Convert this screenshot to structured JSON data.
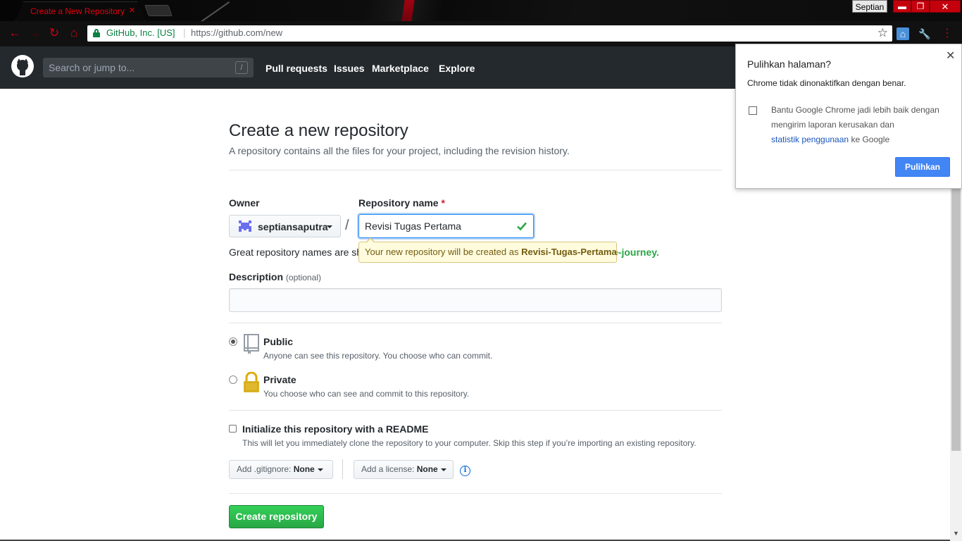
{
  "browser": {
    "tab_title": "Create a New Repository",
    "tab_close": "×",
    "profile_name": "Septian",
    "window_buttons": {
      "minimize": "▬",
      "maximize": "❐",
      "close": "✕"
    },
    "omnibox": {
      "secure_label": "GitHub, Inc. [US]",
      "separator": "|",
      "url": "https://github.com/new",
      "star": "☆"
    },
    "nav_icons": {
      "back": "←",
      "forward": "→",
      "reload": "↻",
      "home": "⌂"
    },
    "extensions": {
      "ext1": "⌂",
      "ext2": "🔧",
      "menu": "⋮"
    }
  },
  "github_header": {
    "search_placeholder": "Search or jump to...",
    "search_shortcut": "/",
    "nav": [
      "Pull requests",
      "Issues",
      "Marketplace",
      "Explore"
    ]
  },
  "page": {
    "title": "Create a new repository",
    "subtitle": "A repository contains all the files for your project, including the revision history.",
    "owner_label": "Owner",
    "owner_value": "septiansaputra",
    "slash": "/",
    "repo_name_label": "Repository name",
    "required_mark": "*",
    "repo_name_value": "Revisi Tugas Pertama",
    "great_names_text": "Great repository names are sh",
    "suggestion_tail": "e-journey.",
    "tooltip_prefix": "Your new repository will be created as",
    "tooltip_name": "Revisi-Tugas-Pertama",
    "description_label": "Description",
    "description_optional": "(optional)",
    "description_value": "",
    "public_title": "Public",
    "public_note": "Anyone can see this repository. You choose who can commit.",
    "private_title": "Private",
    "private_note": "You choose who can see and commit to this repository.",
    "readme_title": "Initialize this repository with a README",
    "readme_note": "This will let you immediately clone the repository to your computer. Skip this step if you’re importing an existing repository.",
    "gitignore_label": "Add .gitignore:",
    "gitignore_value": "None",
    "license_label": "Add a license:",
    "license_value": "None",
    "info": "i",
    "create_button": "Create repository"
  },
  "restore_popup": {
    "title": "Pulihkan halaman?",
    "close": "✕",
    "message": "Chrome tidak dinonaktifkan dengan benar.",
    "checkbox_line1": "Bantu Google Chrome jadi lebih baik dengan",
    "checkbox_line2": "mengirim laporan kerusakan dan",
    "checkbox_link": "statistik penggunaan",
    "checkbox_line3_tail": "ke Google",
    "restore_button": "Pulihkan"
  },
  "colors": {
    "chrome_accent": "#e2000f",
    "github_header": "#24292e",
    "create_button": "#28a745",
    "popup_button": "#4285f4"
  }
}
